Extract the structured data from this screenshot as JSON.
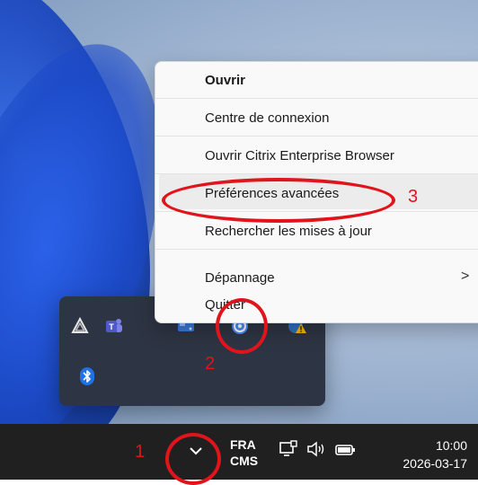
{
  "context_menu": {
    "items": [
      {
        "label": "Ouvrir",
        "bold": true
      },
      {
        "label": "Centre de connexion"
      },
      {
        "label": "Ouvrir Citrix Enterprise Browser"
      },
      {
        "label": "Préférences avancées"
      },
      {
        "label": "Rechercher les mises à jour"
      },
      {
        "label": "Dépannage",
        "submenu_arrow": ">"
      },
      {
        "label": "Quitter"
      }
    ]
  },
  "tray_flyout": {
    "icons": [
      {
        "name": "vpn-triangle-icon"
      },
      {
        "name": "teams-icon"
      },
      {
        "name": "network-drive-icon"
      },
      {
        "name": "citrix-workspace-icon"
      },
      {
        "name": "warning-app-icon"
      },
      {
        "name": "bluetooth-icon"
      }
    ]
  },
  "taskbar": {
    "chevron_icon": "chevron-up-icon",
    "language_top": "FRA",
    "language_bottom": "CMS",
    "time": "10:00",
    "date": "2026-03-17"
  },
  "annotations": {
    "step1": "1",
    "step2": "2",
    "step3": "3",
    "color": "#e0141b"
  }
}
